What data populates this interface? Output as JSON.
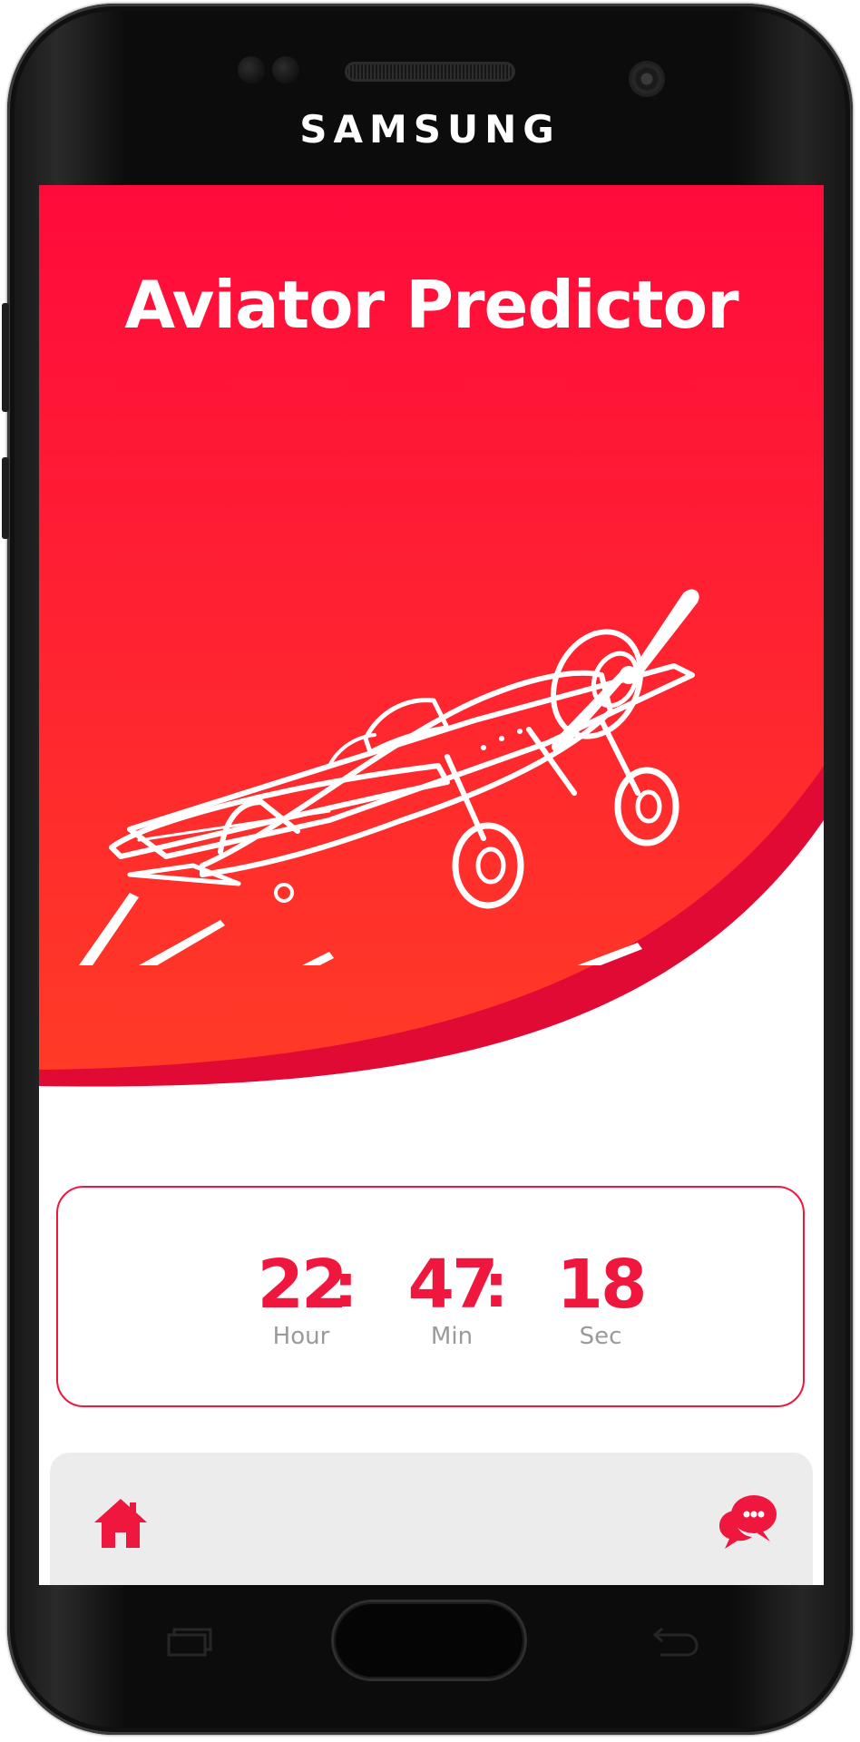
{
  "device": {
    "brand": "SAMSUNG"
  },
  "app": {
    "title": "Aviator Predictor",
    "colors": {
      "accent": "#f0173f",
      "hero_top": "#ff0a3c",
      "hero_bottom": "#ff3a2a",
      "hero_swoosh": "#e00a34",
      "label_gray": "#9a9a9a",
      "nav_background": "#ececec"
    },
    "hero": {
      "illustration": "airplane-illustration"
    }
  },
  "timer": {
    "hours": {
      "value": "22",
      "label": "Hour"
    },
    "minutes": {
      "value": "47",
      "label": "Min"
    },
    "seconds": {
      "value": "18",
      "label": "Sec"
    },
    "separator": ":"
  },
  "bottom_nav": {
    "items": [
      {
        "name": "home",
        "icon": "home-icon"
      },
      {
        "name": "chat",
        "icon": "chat-bubbles-icon"
      }
    ]
  }
}
